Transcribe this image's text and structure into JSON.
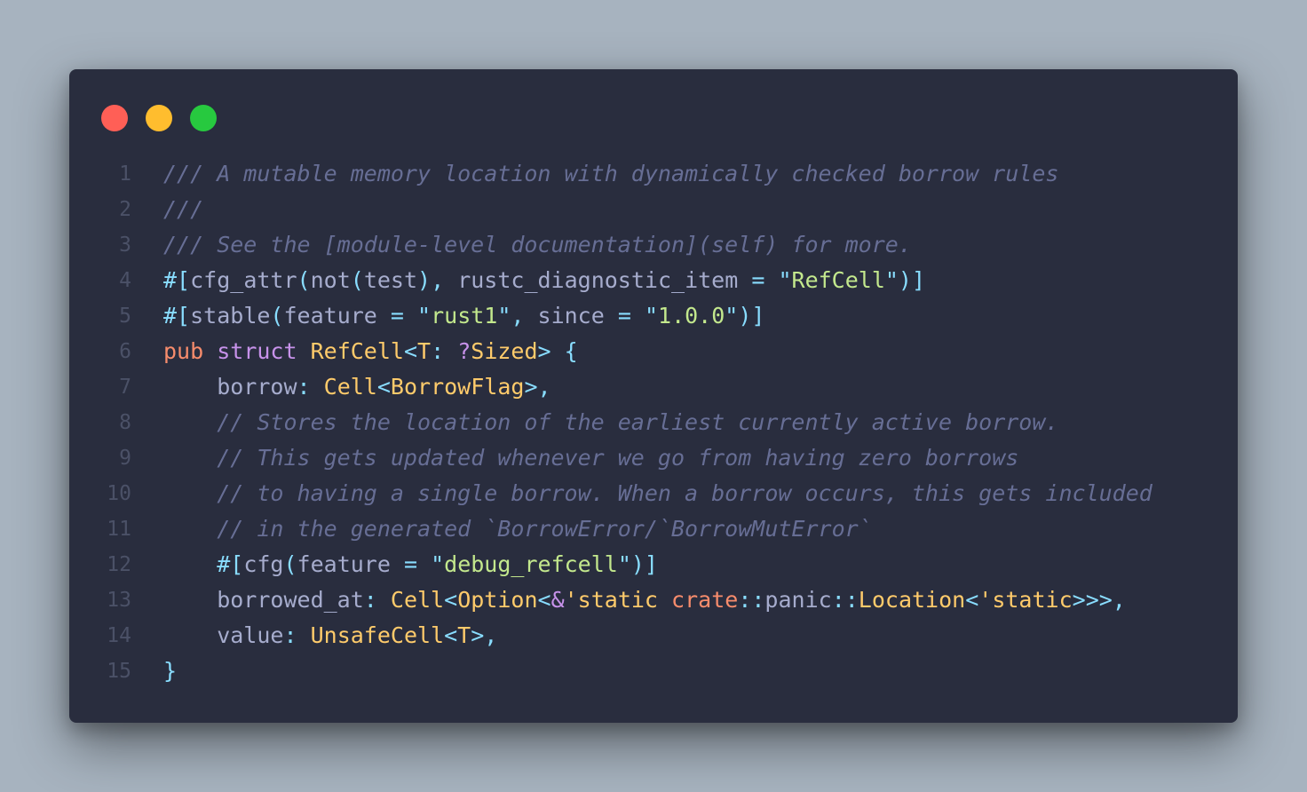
{
  "window": {
    "controls": [
      "close",
      "minimize",
      "maximize"
    ],
    "colors": {
      "close": "#ff5f56",
      "minimize": "#ffbd2e",
      "maximize": "#27c93f",
      "background": "#292d3e"
    }
  },
  "code": {
    "language": "rust",
    "lines": [
      {
        "n": "1",
        "tokens": [
          {
            "t": "/// A mutable memory location with dynamically checked borrow rules",
            "c": "comment"
          }
        ]
      },
      {
        "n": "2",
        "tokens": [
          {
            "t": "///",
            "c": "comment"
          }
        ]
      },
      {
        "n": "3",
        "tokens": [
          {
            "t": "/// See the [module-level documentation](self) for more.",
            "c": "comment"
          }
        ]
      },
      {
        "n": "4",
        "tokens": [
          {
            "t": "#[",
            "c": "punct"
          },
          {
            "t": "cfg_attr",
            "c": "attr"
          },
          {
            "t": "(",
            "c": "punct"
          },
          {
            "t": "not",
            "c": "attr"
          },
          {
            "t": "(",
            "c": "punct"
          },
          {
            "t": "test",
            "c": "attr"
          },
          {
            "t": "),",
            "c": "punct"
          },
          {
            "t": " rustc_diagnostic_item ",
            "c": "attr"
          },
          {
            "t": "=",
            "c": "punct"
          },
          {
            "t": " ",
            "c": "attr"
          },
          {
            "t": "\"",
            "c": "punct"
          },
          {
            "t": "RefCell",
            "c": "string"
          },
          {
            "t": "\")]",
            "c": "punct"
          }
        ]
      },
      {
        "n": "5",
        "tokens": [
          {
            "t": "#[",
            "c": "punct"
          },
          {
            "t": "stable",
            "c": "attr"
          },
          {
            "t": "(",
            "c": "punct"
          },
          {
            "t": "feature ",
            "c": "attr"
          },
          {
            "t": "=",
            "c": "punct"
          },
          {
            "t": " ",
            "c": "attr"
          },
          {
            "t": "\"",
            "c": "punct"
          },
          {
            "t": "rust1",
            "c": "string"
          },
          {
            "t": "\",",
            "c": "punct"
          },
          {
            "t": " since ",
            "c": "attr"
          },
          {
            "t": "=",
            "c": "punct"
          },
          {
            "t": " ",
            "c": "attr"
          },
          {
            "t": "\"",
            "c": "punct"
          },
          {
            "t": "1.0.0",
            "c": "string"
          },
          {
            "t": "\")]",
            "c": "punct"
          }
        ]
      },
      {
        "n": "6",
        "tokens": [
          {
            "t": "pub",
            "c": "kw2"
          },
          {
            "t": " ",
            "c": "attr"
          },
          {
            "t": "struct",
            "c": "kw"
          },
          {
            "t": " ",
            "c": "attr"
          },
          {
            "t": "RefCell",
            "c": "type"
          },
          {
            "t": "<",
            "c": "punct"
          },
          {
            "t": "T",
            "c": "type"
          },
          {
            "t": ":",
            "c": "punct"
          },
          {
            "t": " ",
            "c": "attr"
          },
          {
            "t": "?",
            "c": "kw"
          },
          {
            "t": "Sized",
            "c": "type"
          },
          {
            "t": ">",
            "c": "punct"
          },
          {
            "t": " ",
            "c": "attr"
          },
          {
            "t": "{",
            "c": "punct"
          }
        ]
      },
      {
        "n": "7",
        "tokens": [
          {
            "t": "    borrow",
            "c": "field"
          },
          {
            "t": ":",
            "c": "punct"
          },
          {
            "t": " ",
            "c": "attr"
          },
          {
            "t": "Cell",
            "c": "type"
          },
          {
            "t": "<",
            "c": "punct"
          },
          {
            "t": "BorrowFlag",
            "c": "type"
          },
          {
            "t": ">,",
            "c": "punct"
          }
        ]
      },
      {
        "n": "8",
        "tokens": [
          {
            "t": "    ",
            "c": "attr"
          },
          {
            "t": "// Stores the location of the earliest currently active borrow.",
            "c": "comment"
          }
        ]
      },
      {
        "n": "9",
        "tokens": [
          {
            "t": "    ",
            "c": "attr"
          },
          {
            "t": "// This gets updated whenever we go from having zero borrows",
            "c": "comment"
          }
        ]
      },
      {
        "n": "10",
        "tokens": [
          {
            "t": "    ",
            "c": "attr"
          },
          {
            "t": "// to having a single borrow. When a borrow occurs, this gets included",
            "c": "comment"
          }
        ]
      },
      {
        "n": "11",
        "tokens": [
          {
            "t": "    ",
            "c": "attr"
          },
          {
            "t": "// in the generated `BorrowError/`BorrowMutError`",
            "c": "comment"
          }
        ]
      },
      {
        "n": "12",
        "tokens": [
          {
            "t": "    ",
            "c": "attr"
          },
          {
            "t": "#[",
            "c": "punct"
          },
          {
            "t": "cfg",
            "c": "attr"
          },
          {
            "t": "(",
            "c": "punct"
          },
          {
            "t": "feature ",
            "c": "attr"
          },
          {
            "t": "=",
            "c": "punct"
          },
          {
            "t": " ",
            "c": "attr"
          },
          {
            "t": "\"",
            "c": "punct"
          },
          {
            "t": "debug_refcell",
            "c": "string"
          },
          {
            "t": "\")]",
            "c": "punct"
          }
        ]
      },
      {
        "n": "13",
        "tokens": [
          {
            "t": "    borrowed_at",
            "c": "field"
          },
          {
            "t": ":",
            "c": "punct"
          },
          {
            "t": " ",
            "c": "attr"
          },
          {
            "t": "Cell",
            "c": "type"
          },
          {
            "t": "<",
            "c": "punct"
          },
          {
            "t": "Option",
            "c": "type"
          },
          {
            "t": "<",
            "c": "punct"
          },
          {
            "t": "&",
            "c": "kw"
          },
          {
            "t": "'static",
            "c": "type"
          },
          {
            "t": " ",
            "c": "attr"
          },
          {
            "t": "crate",
            "c": "kw2"
          },
          {
            "t": "::",
            "c": "punct"
          },
          {
            "t": "panic",
            "c": "attr"
          },
          {
            "t": "::",
            "c": "punct"
          },
          {
            "t": "Location",
            "c": "type"
          },
          {
            "t": "<",
            "c": "punct"
          },
          {
            "t": "'static",
            "c": "type"
          },
          {
            "t": ">>>,",
            "c": "punct"
          }
        ]
      },
      {
        "n": "14",
        "tokens": [
          {
            "t": "    value",
            "c": "field"
          },
          {
            "t": ":",
            "c": "punct"
          },
          {
            "t": " ",
            "c": "attr"
          },
          {
            "t": "UnsafeCell",
            "c": "type"
          },
          {
            "t": "<",
            "c": "punct"
          },
          {
            "t": "T",
            "c": "type"
          },
          {
            "t": ">,",
            "c": "punct"
          }
        ]
      },
      {
        "n": "15",
        "tokens": [
          {
            "t": "}",
            "c": "punct"
          }
        ]
      }
    ]
  }
}
